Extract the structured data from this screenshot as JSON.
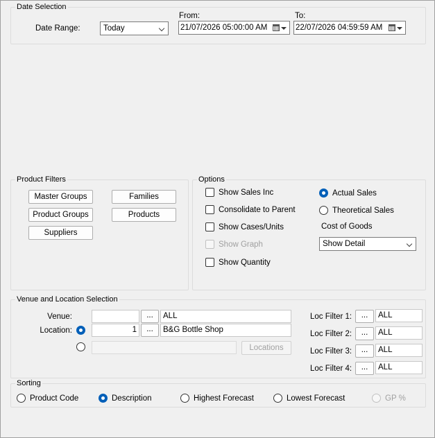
{
  "date_selection": {
    "title": "Date Selection",
    "date_range_label": "Date Range:",
    "date_range_value": "Today",
    "from_label": "From:",
    "from_value": "21/07/2026 05:00:00 AM",
    "to_label": "To:",
    "to_value": "22/07/2026 04:59:59 AM"
  },
  "product_filters": {
    "title": "Product Filters",
    "master_groups": "Master Groups",
    "families": "Families",
    "product_groups": "Product Groups",
    "products": "Products",
    "suppliers": "Suppliers"
  },
  "options": {
    "title": "Options",
    "show_sales_inc": "Show Sales Inc",
    "consolidate_to_parent": "Consolidate to Parent",
    "show_cases_units": "Show Cases/Units",
    "show_graph": "Show Graph",
    "show_quantity": "Show Quantity",
    "actual_sales": "Actual Sales",
    "theoretical_sales": "Theoretical Sales",
    "cost_of_goods_label": "Cost of Goods",
    "cost_of_goods_value": "Show Detail"
  },
  "venue_location": {
    "title": "Venue and Location Selection",
    "venue_label": "Venue:",
    "venue_code": "",
    "venue_browse": "...",
    "venue_value": "ALL",
    "location_label": "Location:",
    "location_code": "1",
    "location_browse": "...",
    "location_value": "B&G Bottle Shop",
    "locations_button": "Locations",
    "loc_filters": [
      {
        "label": "Loc Filter 1:",
        "browse": "...",
        "value": "ALL"
      },
      {
        "label": "Loc Filter 2:",
        "browse": "...",
        "value": "ALL"
      },
      {
        "label": "Loc Filter 3:",
        "browse": "...",
        "value": "ALL"
      },
      {
        "label": "Loc Filter 4:",
        "browse": "...",
        "value": "ALL"
      }
    ]
  },
  "sorting": {
    "title": "Sorting",
    "product_code": "Product Code",
    "description": "Description",
    "highest_forecast": "Highest Forecast",
    "lowest_forecast": "Lowest Forecast",
    "gp_percent": "GP %"
  },
  "colors": {
    "accent": "#005fb8",
    "background": "#f0f0f0",
    "group_border": "#dcdcdc"
  }
}
